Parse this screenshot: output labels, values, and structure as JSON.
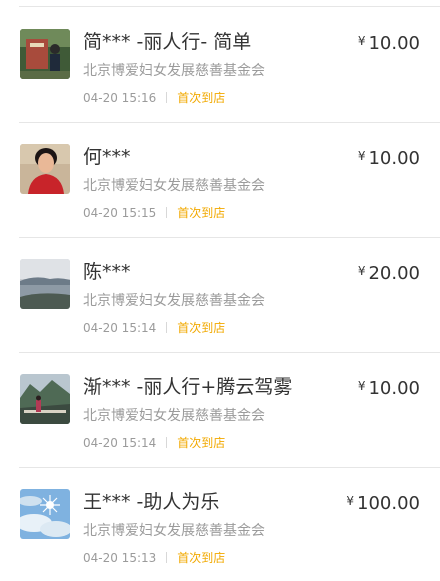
{
  "currency_symbol": "¥",
  "tag_color": "#f2a900",
  "donations": [
    {
      "name": "简*** -丽人行- 简单",
      "amount": "10.00",
      "org": "北京博爱妇女发展慈善基金会",
      "time": "04-20 15:16",
      "tag": "首次到店",
      "avatar_icon": "group-photo-avatar-icon"
    },
    {
      "name": "何***",
      "amount": "10.00",
      "org": "北京博爱妇女发展慈善基金会",
      "time": "04-20 15:15",
      "tag": "首次到店",
      "avatar_icon": "portrait-avatar-icon"
    },
    {
      "name": "陈***",
      "amount": "20.00",
      "org": "北京博爱妇女发展慈善基金会",
      "time": "04-20 15:14",
      "tag": "首次到店",
      "avatar_icon": "seaside-avatar-icon"
    },
    {
      "name": "渐*** -丽人行+腾云驾雾",
      "amount": "10.00",
      "org": "北京博爱妇女发展慈善基金会",
      "time": "04-20 15:14",
      "tag": "首次到店",
      "avatar_icon": "mountain-avatar-icon"
    },
    {
      "name": "王*** -助人为乐",
      "amount": "100.00",
      "org": "北京博爱妇女发展慈善基金会",
      "time": "04-20 15:13",
      "tag": "首次到店",
      "avatar_icon": "sky-sun-avatar-icon"
    }
  ]
}
